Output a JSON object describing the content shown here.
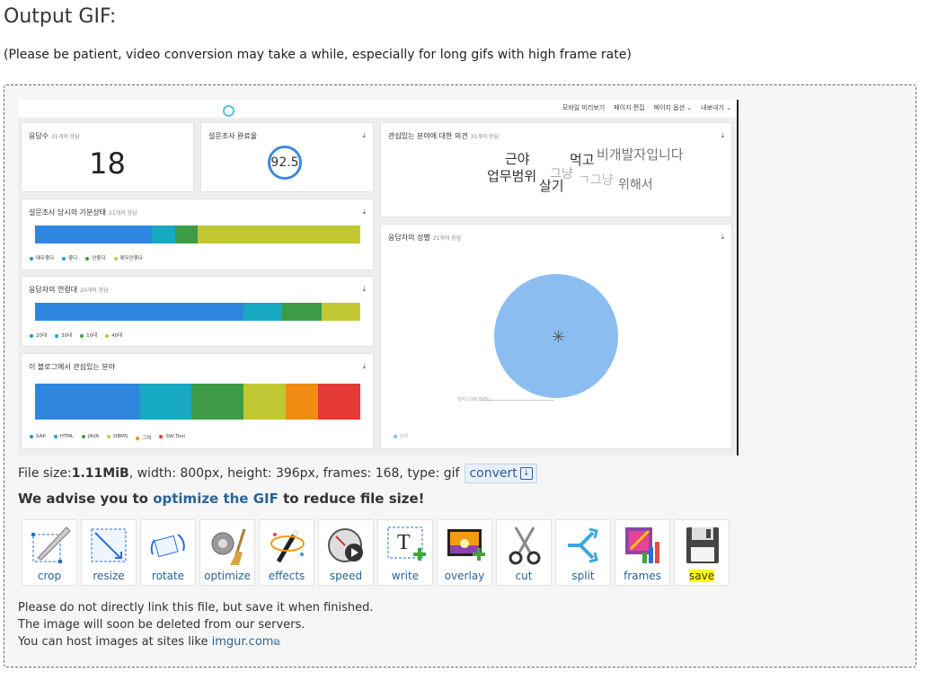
{
  "page": {
    "title": "Output GIF:",
    "note": "(Please be patient, video conversion may take a while, especially for long gifs with high frame rate)"
  },
  "gif_preview": {
    "toolbar": [
      "모바일 미리보기",
      "페이지 편집",
      "페이지 옵션 ⌄",
      "내보내기 ⌄"
    ],
    "cards": {
      "responses": {
        "title": "응답수",
        "count": "31개의 응답",
        "value": "18"
      },
      "completion": {
        "title": "설문조사 완료율",
        "value": "92.5"
      },
      "opinion": {
        "title": "관심있는 분야에 대한 의견",
        "count": "31개의 응답",
        "words": [
          "근야",
          "업무범위",
          "살기",
          "그냥",
          "ㄱ그냥",
          "먹고",
          "비개발자입니다",
          "위해서"
        ]
      },
      "mood": {
        "title": "설문조사 당시의 기분상태",
        "count": "21개의 응답",
        "legend": [
          "매우좋다",
          "좋다",
          "안좋다",
          "매우안좋다"
        ]
      },
      "age": {
        "title": "응답자의 연령대",
        "count": "20개의 응답",
        "legend": [
          "20대",
          "30대",
          "10대",
          "40대"
        ]
      },
      "gender": {
        "title": "응답자의 성별",
        "count": "21개의 응답",
        "pie_label": "남자 (100.00%)",
        "legend": "남자"
      },
      "interest": {
        "title": "이 블로그에서 관심있는 분야",
        "legend": [
          "SAP",
          "HTML",
          "JAVA",
          "DBMS",
          "그외",
          "SW Tool"
        ]
      }
    },
    "colors": {
      "blue": "#2e86de",
      "teal": "#17a8c2",
      "green": "#3d9b47",
      "olive": "#c1c833",
      "orange": "#f18b12",
      "red": "#e53935",
      "pie": "#8bbdf0"
    }
  },
  "file_info": {
    "prefix": "File size: ",
    "size": "1.11MiB",
    "details": ", width: 800px, height: 396px, frames: 168, type: gif",
    "convert_label": "convert"
  },
  "advise": {
    "before": "We advise you to ",
    "link": "optimize the GIF",
    "after": " to reduce file size!"
  },
  "tools": [
    {
      "label": "crop",
      "icon": "crop-icon"
    },
    {
      "label": "resize",
      "icon": "resize-icon"
    },
    {
      "label": "rotate",
      "icon": "rotate-icon"
    },
    {
      "label": "optimize",
      "icon": "optimize-icon"
    },
    {
      "label": "effects",
      "icon": "effects-icon"
    },
    {
      "label": "speed",
      "icon": "speed-icon"
    },
    {
      "label": "write",
      "icon": "write-icon"
    },
    {
      "label": "overlay",
      "icon": "overlay-icon"
    },
    {
      "label": "cut",
      "icon": "cut-icon"
    },
    {
      "label": "split",
      "icon": "split-icon"
    },
    {
      "label": "frames",
      "icon": "frames-icon"
    },
    {
      "label": "save",
      "icon": "save-icon"
    }
  ],
  "footer": {
    "line1": "Please do not directly link this file, but save it when finished.",
    "line2": "The image will soon be deleted from our servers.",
    "line3_prefix": "You can host images at sites like ",
    "link": "imgur.com"
  }
}
